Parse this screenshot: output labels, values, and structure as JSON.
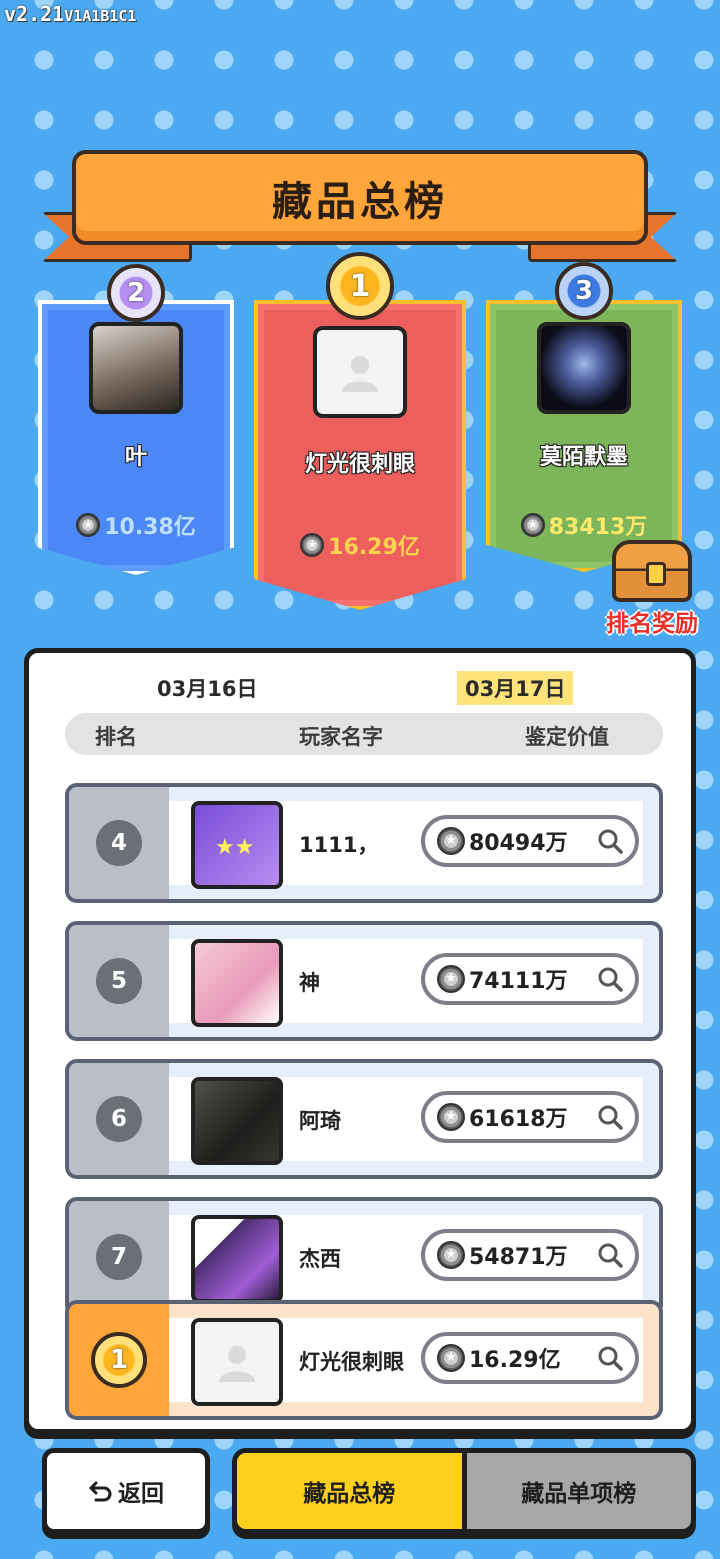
{
  "version": {
    "main": "v2.21",
    "build": "V1A1B1C1"
  },
  "title": "藏品总榜",
  "podium": [
    {
      "rank": "2",
      "name": "叶",
      "value": "10.38亿"
    },
    {
      "rank": "1",
      "name": "灯光很刺眼",
      "value": "16.29亿"
    },
    {
      "rank": "3",
      "name": "莫陌默墨",
      "value": "83413万"
    }
  ],
  "reward_label": "排名奖励",
  "dates": {
    "prev": "03月16日",
    "current": "03月17日"
  },
  "columns": {
    "rank": "排名",
    "player": "玩家名字",
    "value": "鉴定价值"
  },
  "rows": [
    {
      "rank": "4",
      "name": "1111，",
      "value": "80494万"
    },
    {
      "rank": "5",
      "name": "神",
      "value": "74111万"
    },
    {
      "rank": "6",
      "name": "阿琦",
      "value": "61618万"
    },
    {
      "rank": "7",
      "name": "杰西",
      "value": "54871万"
    }
  ],
  "self_row": {
    "rank": "1",
    "name": "灯光很刺眼",
    "value": "16.29亿"
  },
  "buttons": {
    "back": "返回",
    "tab_total": "藏品总榜",
    "tab_single": "藏品单项榜"
  },
  "colors": {
    "background": "#4aa9f0",
    "banner": "#ffa53a",
    "active_tab": "#fdd01e",
    "second": "#4c88f5",
    "first": "#ec5f5d",
    "third": "#7db65a"
  }
}
